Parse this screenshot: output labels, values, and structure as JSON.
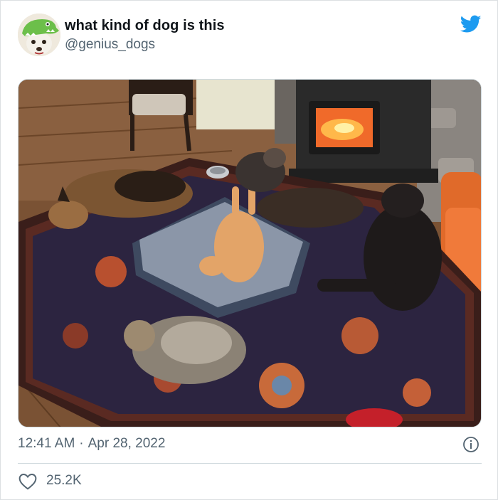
{
  "tweet": {
    "author": {
      "display_name": "what kind of dog is this",
      "handle": "@genius_dogs",
      "avatar_icon": "dog-with-dinosaur-hat-avatar"
    },
    "media": {
      "icon": "photo-dogs-and-cat-on-rug-by-wood-stove"
    },
    "time": "12:41 AM",
    "separator": "·",
    "date": "Apr 28, 2022",
    "likes": "25.2K"
  },
  "colors": {
    "brand_blue": "#1d9bf0",
    "text_primary": "#0f1419",
    "text_secondary": "#536471",
    "border": "#cfd9de"
  },
  "icons": {
    "brand": "twitter-bird-icon",
    "info": "info-icon",
    "like": "heart-icon"
  }
}
